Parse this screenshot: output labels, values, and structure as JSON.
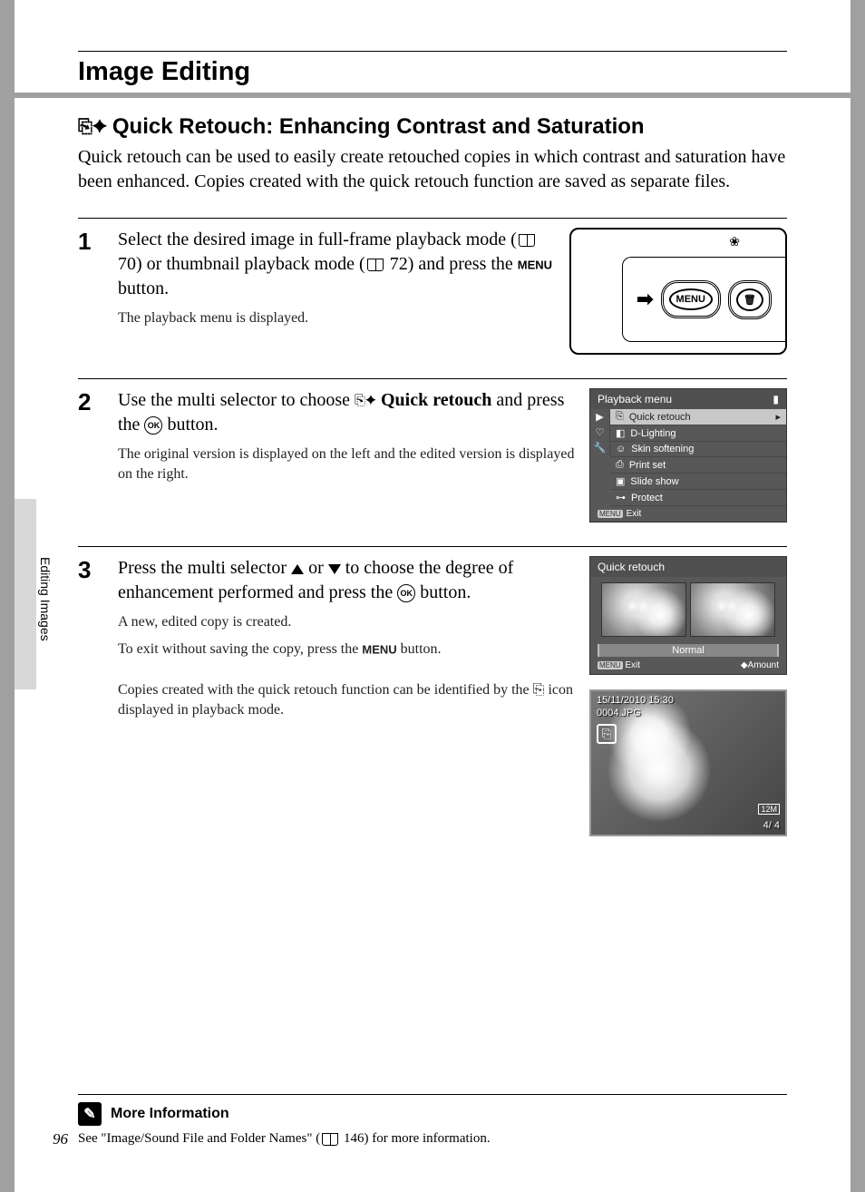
{
  "page_number": "96",
  "side_tab": "Editing Images",
  "title": "Image Editing",
  "subtitle": "Quick Retouch: Enhancing Contrast and Saturation",
  "intro": "Quick retouch can be used to easily create retouched copies in which contrast and saturation have been enhanced. Copies created with the quick retouch function are saved as separate files.",
  "steps": {
    "s1": {
      "num": "1",
      "text_a": "Select the desired image in full-frame playback mode (",
      "ref_a": " 70) or thumbnail playback mode (",
      "ref_b": " 72) and press the ",
      "menu": "MENU",
      "text_b": " button.",
      "sub": "The playback menu is displayed.",
      "illus_menu": "MENU"
    },
    "s2": {
      "num": "2",
      "text_a": "Use the multi selector to choose ",
      "bold_a": "Quick retouch",
      "text_b": " and press the ",
      "text_c": " button.",
      "sub": "The original version is displayed on the left and the edited version is displayed on the right.",
      "ok": "OK",
      "lcd": {
        "header": "Playback menu",
        "items": [
          "Quick retouch",
          "D-Lighting",
          "Skin softening",
          "Print set",
          "Slide show",
          "Protect"
        ],
        "exit": "Exit",
        "exit_badge": "MENU"
      }
    },
    "s3": {
      "num": "3",
      "text_a": "Press the multi selector ",
      "text_b": " or ",
      "text_c": " to choose the degree of enhancement performed and press the ",
      "text_d": " button.",
      "ok": "OK",
      "sub1": "A new, edited copy is created.",
      "sub2_a": "To exit without saving the copy, press the ",
      "sub2_menu": "MENU",
      "sub2_b": " button.",
      "sub3_a": "Copies created with the quick retouch function can be identified by the ",
      "sub3_b": " icon displayed in playback mode.",
      "qr": {
        "header": "Quick retouch",
        "normal": "Normal",
        "exit": "Exit",
        "exit_badge": "MENU",
        "amount": "Amount"
      },
      "pb": {
        "datetime": "15/11/2010 15:30",
        "filename": "0004.JPG",
        "res": "12M",
        "counter": "4/    4"
      }
    }
  },
  "more_info": {
    "heading": "More Information",
    "body_a": "See \"Image/Sound File and Folder Names\" (",
    "ref": " 146) for more information."
  }
}
